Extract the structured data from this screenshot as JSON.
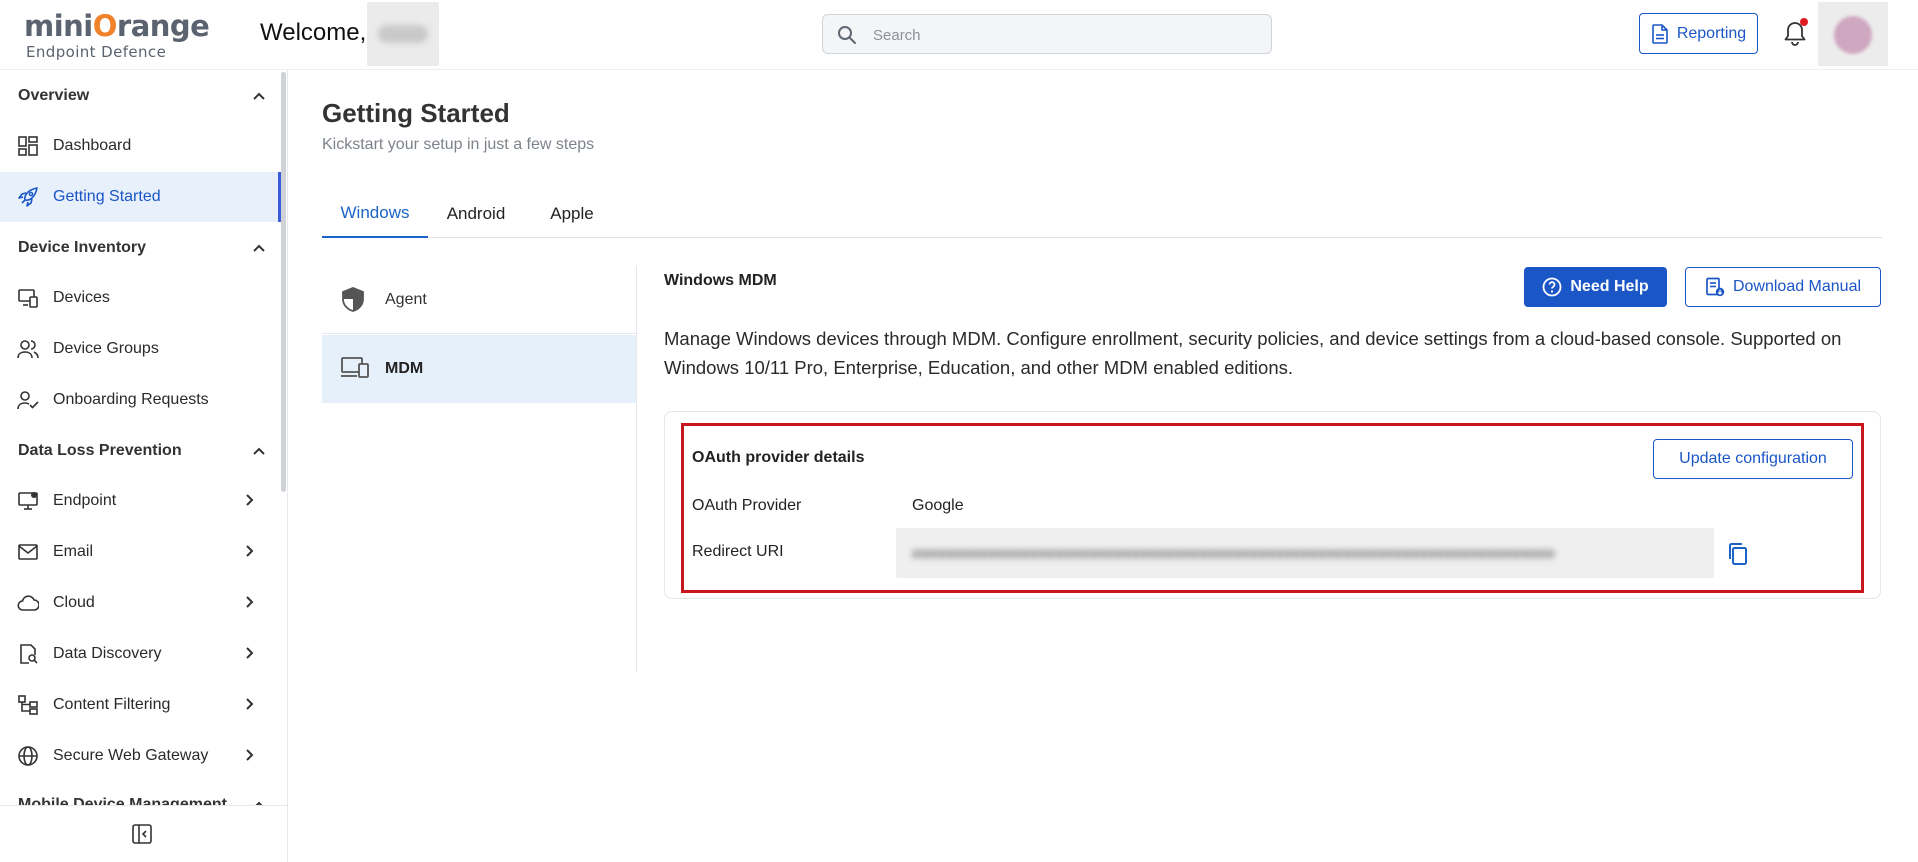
{
  "header": {
    "logo_main_prefix": "mini",
    "logo_main_accent": "O",
    "logo_main_suffix": "range",
    "logo_sub": "Endpoint Defence",
    "welcome": "Welcome,",
    "search_placeholder": "Search",
    "reporting_label": "Reporting",
    "notification_dot_color": "#e11b22"
  },
  "sidebar": {
    "sections": [
      {
        "label": "Overview"
      },
      {
        "label": "Device Inventory"
      },
      {
        "label": "Data Loss Prevention"
      },
      {
        "label": "Mobile Device Management"
      }
    ],
    "items": [
      {
        "label": "Dashboard",
        "icon": "dashboard-icon"
      },
      {
        "label": "Getting Started",
        "icon": "rocket-icon",
        "active": true
      },
      {
        "label": "Devices",
        "icon": "devices-icon"
      },
      {
        "label": "Device Groups",
        "icon": "users-icon"
      },
      {
        "label": "Onboarding Requests",
        "icon": "user-check-icon"
      },
      {
        "label": "Endpoint",
        "icon": "monitor-icon"
      },
      {
        "label": "Email",
        "icon": "mail-icon"
      },
      {
        "label": "Cloud",
        "icon": "cloud-icon"
      },
      {
        "label": "Data Discovery",
        "icon": "file-search-icon"
      },
      {
        "label": "Content Filtering",
        "icon": "filter-tree-icon"
      },
      {
        "label": "Secure Web Gateway",
        "icon": "globe-icon"
      }
    ]
  },
  "main": {
    "title": "Getting Started",
    "subtitle": "Kickstart your setup in just a few steps",
    "tabs": [
      {
        "label": "Windows",
        "active": true
      },
      {
        "label": "Android"
      },
      {
        "label": "Apple"
      }
    ],
    "subnav": [
      {
        "label": "Agent"
      },
      {
        "label": "MDM",
        "active": true
      }
    ],
    "content": {
      "title": "Windows MDM",
      "need_help": "Need Help",
      "download_manual": "Download Manual",
      "description": "Manage Windows devices through MDM. Configure enrollment, security policies, and device settings from a cloud-based console. Supported on Windows 10/11 Pro, Enterprise, Education, and other MDM enabled editions."
    },
    "oauth": {
      "title": "OAuth provider details",
      "update_button": "Update configuration",
      "provider_label": "OAuth Provider",
      "provider_value": "Google",
      "redirect_label": "Redirect URI"
    }
  },
  "colors": {
    "primary": "#1b56c7",
    "highlight_border": "#c8161e",
    "active_bg": "#e7f0fb"
  }
}
